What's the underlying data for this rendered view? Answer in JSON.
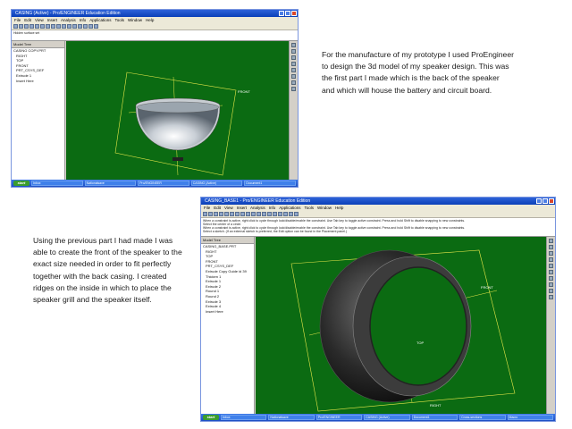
{
  "captions": {
    "first": "For the manufacture of my prototype I used ProEngineer to design the 3d model of my speaker design. This was the first part I made which is the back of the speaker and which will house the battery and circuit board.",
    "second": "Using the previous part I had made I was able to create the front of the speaker to the exact size needed in order to fit perfectly together with the back casing. I created ridges on the inside in which to place the speaker grill and the speaker itself."
  },
  "screenshot_top": {
    "window_title": "CASING (Active) - Pro/ENGINEER Education Edition",
    "menu": [
      "File",
      "Edit",
      "View",
      "Insert",
      "Analysis",
      "Info",
      "Applications",
      "Tools",
      "Window",
      "Help"
    ],
    "message": "Hidden surface set",
    "model_tree": {
      "header": "Model Tree",
      "items": [
        "CASING COPY.PRT",
        "RIGHT",
        "TOP",
        "FRONT",
        "PRT_CSYS_DEF",
        "Extrude 1",
        "Insert Here"
      ]
    },
    "viewport_label": "FRONT",
    "taskbar": {
      "start": "start",
      "tasks": [
        "Inbox",
        "Nationalsave",
        "Pro/ENGINEER",
        "CASING (Active)",
        "Document1"
      ]
    }
  },
  "screenshot_bottom": {
    "window_title": "CASING_BASE1 - Pro/ENGINEER Education Edition",
    "menu": [
      "File",
      "Edit",
      "View",
      "Insert",
      "Analysis",
      "Info",
      "Applications",
      "Tools",
      "Window",
      "Help"
    ],
    "messages": [
      "When a constraint is active, right click to cycle through lock/disable/enable the constraint. Use Tab key to toggle active constraint. Press and hold Shift to disable snapping to new constraints.",
      "Select the center of a circle.",
      "When a constraint is active, right click to cycle through lock/disable/enable the constraint. Use Tab key to toggle active constraint. Press and hold Shift to disable snapping to new constraints.",
      "Select a sketch. (If an external sketch is preferred, the Edit option can be found in the Placement panel.)"
    ],
    "model_tree": {
      "header": "Model Tree",
      "items": [
        "CASING_BASE.PRT",
        "RIGHT",
        "TOP",
        "FRONT",
        "PRT_CSYS_DEF",
        "Extrude Copy Guide id 39",
        "Thicken 1",
        "Extrude 1",
        "Extrude 2",
        "Round 1",
        "Round 2",
        "Extrude 3",
        "Extrude 4",
        "Insert Here"
      ]
    },
    "viewport_labels": [
      "FRONT",
      "TOP",
      "RIGHT"
    ],
    "taskbar": {
      "start": "start",
      "tasks": [
        "Inbox",
        "Nationalsave",
        "Pro/ENGINEER",
        "CASING (Active)",
        "Document1",
        "Cross-sections",
        "Macro"
      ]
    }
  },
  "colors": {
    "viewport_green": "#0b6b12",
    "title_blue": "#0a3fb8",
    "datum_yellow": "#e8e84a"
  }
}
